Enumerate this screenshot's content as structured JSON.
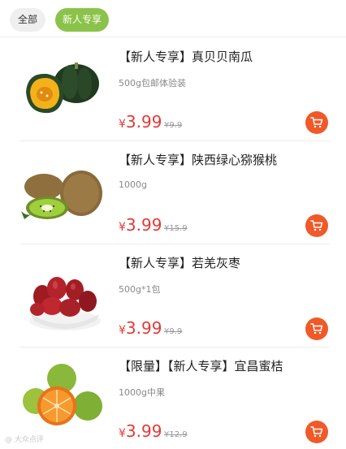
{
  "tabs": {
    "all": "全部",
    "new_user": "新人专享"
  },
  "products": [
    {
      "title": "【新人专享】真贝贝南瓜",
      "spec": "500g包邮体验装",
      "currency": "¥",
      "price": "3.99",
      "original_price": "¥9.9"
    },
    {
      "title": "【新人专享】陕西绿心猕猴桃",
      "spec": "1000g",
      "currency": "¥",
      "price": "3.99",
      "original_price": "¥15.9"
    },
    {
      "title": "【新人专享】若羌灰枣",
      "spec": "500g*1包",
      "currency": "¥",
      "price": "3.99",
      "original_price": "¥9.9"
    },
    {
      "title": "【限量】【新人专享】宜昌蜜桔",
      "spec": "1000g中果",
      "currency": "¥",
      "price": "3.99",
      "original_price": "¥12.9"
    }
  ],
  "icons": {
    "cart": "cart-icon"
  },
  "colors": {
    "accent": "#8bc34a",
    "price": "#e53935",
    "cart_button": "#f05a28"
  },
  "watermark": "@ 大众点评"
}
